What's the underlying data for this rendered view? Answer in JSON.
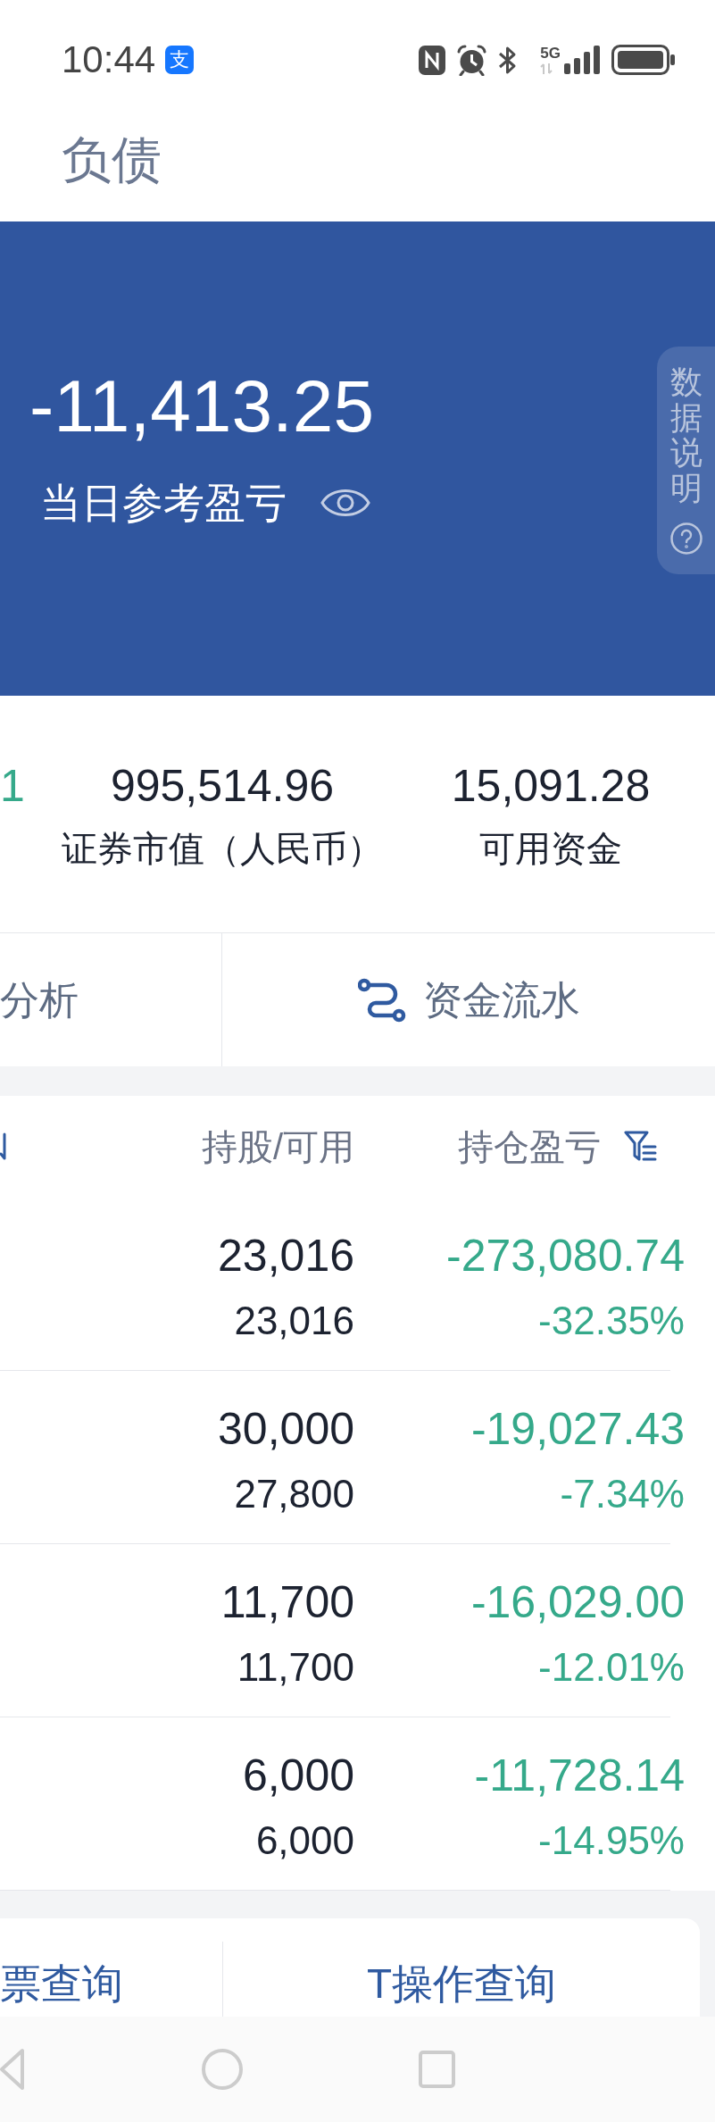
{
  "status_bar": {
    "time": "10:44",
    "app_badge": "支",
    "network": "5G"
  },
  "tabs": [
    {
      "label": "负债",
      "selected": false
    }
  ],
  "summary": {
    "value": "-11,413.25",
    "label": "当日参考盈亏",
    "info_tab": "数据说明"
  },
  "stats": [
    {
      "value": "1",
      "kind": "loss"
    },
    {
      "value": "995,514.96",
      "label": "证券市值（人民币）",
      "kind": "plain"
    },
    {
      "value": "15,091.28",
      "label": "可用资金",
      "kind": "plain"
    }
  ],
  "actions": [
    {
      "label": "分析",
      "kind": "text"
    },
    {
      "label": "资金流水",
      "kind": "icon_text"
    }
  ],
  "table": {
    "columns": [
      {
        "label": "持股/可用",
        "filter": false
      },
      {
        "label": "持仓盈亏",
        "filter": true
      }
    ],
    "rows": [
      {
        "shares": "23,016",
        "available": "23,016",
        "pnl": "-273,080.74",
        "pnl_pct": "-32.35%"
      },
      {
        "shares": "30,000",
        "available": "27,800",
        "pnl": "-19,027.43",
        "pnl_pct": "-7.34%"
      },
      {
        "shares": "11,700",
        "available": "11,700",
        "pnl": "-16,029.00",
        "pnl_pct": "-12.01%"
      },
      {
        "shares": "6,000",
        "available": "6,000",
        "pnl": "-11,728.14",
        "pnl_pct": "-14.95%"
      }
    ]
  },
  "bottom_actions": [
    {
      "label": "票查询"
    },
    {
      "label": "T操作查询"
    }
  ]
}
